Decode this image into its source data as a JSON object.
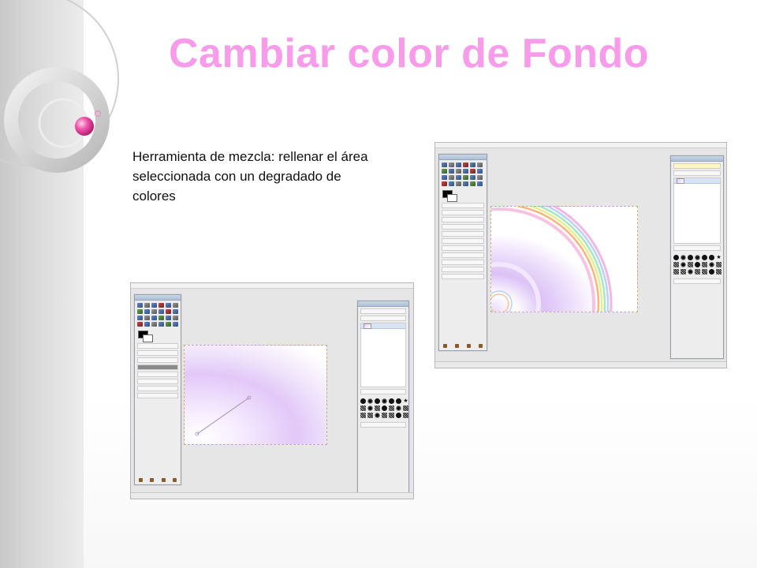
{
  "slide": {
    "title": "Cambiar color de Fondo",
    "body_text": "Herramienta de mezcla: rellenar el área seleccionada con un degradado de colores"
  },
  "colors": {
    "title": "#f79bea",
    "accent_ball": "#ee4fa3",
    "gradient_light": "#e2c8f8"
  },
  "icons": [
    "toolbox-icon",
    "layer-thumbnail-icon",
    "brush-icon",
    "foreground-color-icon",
    "background-color-icon",
    "decorative-ring-icon",
    "pink-ball-icon"
  ]
}
